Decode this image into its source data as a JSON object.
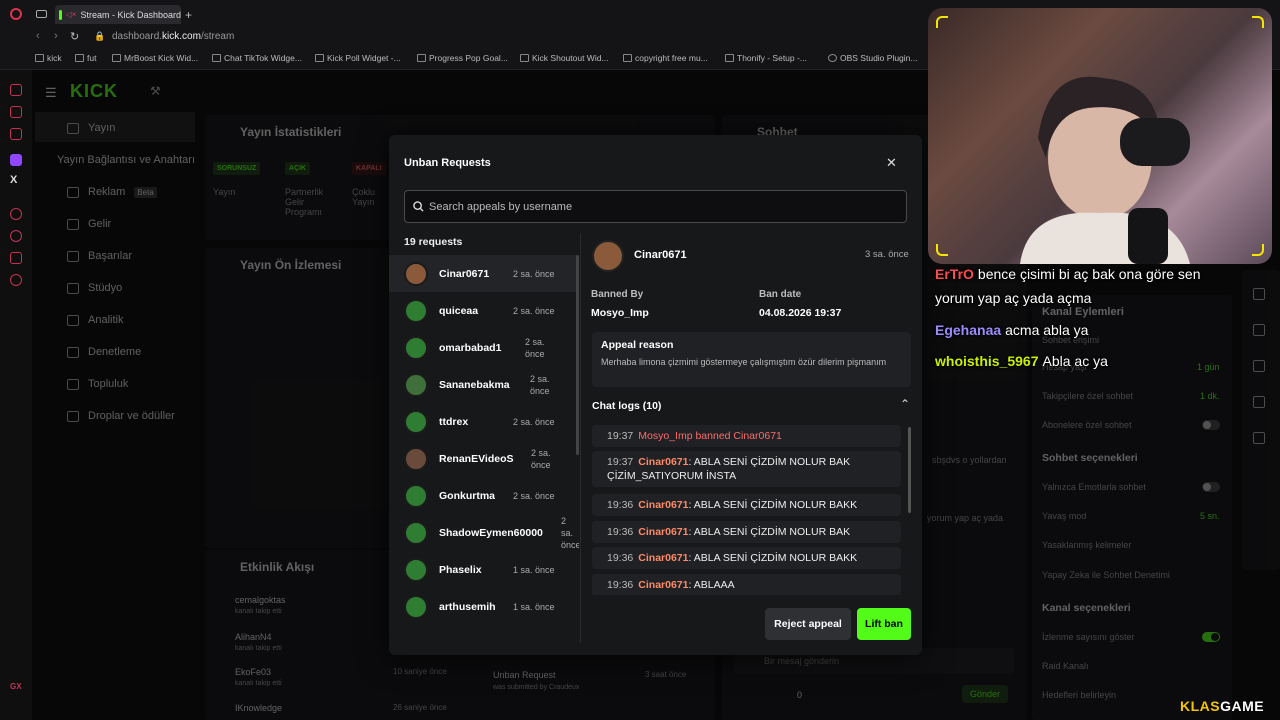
{
  "browser": {
    "tab_title": "Stream - Kick Dashboard",
    "url_prefix": "dashboard.",
    "url_domain": "kick.com",
    "url_path": "/stream",
    "bookmarks": [
      "kick",
      "fut",
      "MrBoost Kick Wid...",
      "Chat TikTok Widge...",
      "Kick Poll Widget -...",
      "Progress Pop Goal...",
      "Kick Shoutout Wid...",
      "copyright free mu...",
      "Thonify - Setup -...",
      "OBS Studio Plugin..."
    ]
  },
  "sidebar": {
    "logo": "KICK",
    "items": [
      {
        "label": "Yayın"
      },
      {
        "label": "Yayın Bağlantısı ve Anahtarı"
      },
      {
        "label": "Reklam",
        "badge": "Beta"
      },
      {
        "label": "Gelir"
      },
      {
        "label": "Başarılar"
      },
      {
        "label": "Stüdyo"
      },
      {
        "label": "Analitik"
      },
      {
        "label": "Denetleme"
      },
      {
        "label": "Topluluk"
      },
      {
        "label": "Droplar ve ödüller"
      }
    ]
  },
  "background": {
    "stats_title": "Yayın İstatistikleri",
    "stats_pills": [
      "SORUNSUZ",
      "AÇIK",
      "KAPALI"
    ],
    "stats_labels": [
      "Yayın",
      "Partnerlik Gelir Programı",
      "Çoklu Yayın"
    ],
    "preview_title": "Yayın Ön İzlemesi",
    "activity_title": "Etkinlik Akışı",
    "activity": [
      {
        "user": "cemalgoktas",
        "sub": "kanalı takip etti"
      },
      {
        "user": "AlihanN4",
        "sub": "kanalı takip etti"
      },
      {
        "user": "EkoFe03",
        "sub": "kanalı takip etti",
        "time": "10 saniye önce"
      },
      {
        "user": "IKnowledge",
        "time": "26 saniye önce"
      }
    ],
    "chat_title": "Sohbet",
    "chat_placeholder": "Bir mesaj gönderin",
    "chat_send": "Gönder",
    "chat_count": "0",
    "unban_note_title": "Unban Request",
    "unban_note_sub": "was submitted by Craudeux",
    "unban_note_time": "3 saat önce",
    "chat_snippet_1": "sbşdvs o yollardan",
    "chat_snippet_2": "yorum yap aç yada",
    "channel_actions_title": "Kanal Eylemleri",
    "chat_access": "Sohbet erişimi",
    "account_age": "Hesap yaşı",
    "account_age_val": "1 gün",
    "followers_only": "Takipçilere özel sohbet",
    "followers_only_val": "1 dk.",
    "subs_only": "Abonelere özel sohbet",
    "chat_options_title": "Sohbet seçenekleri",
    "emotes_only": "Yalnızca Emotlarla sohbet",
    "slow_mode": "Yavaş mod",
    "slow_mode_val": "5 sn.",
    "banned_words": "Yasaklanmış kelimeler",
    "ai_moderation": "Yapay Zeka ile Sohbet Denetimi",
    "channel_options_title": "Kanal seçenekleri",
    "show_viewers": "İzlenme sayısını göster",
    "raid": "Raid Kanalı",
    "goals": "Hedefleri belirleyin"
  },
  "modal": {
    "title": "Unban Requests",
    "close": "✕",
    "search_placeholder": "Search appeals by username",
    "request_count": "19 requests",
    "requests": [
      {
        "user": "Cinar0671",
        "time": "2 sa. önce",
        "color": "#8a5a3a"
      },
      {
        "user": "quiceaa",
        "time": "2 sa. önce",
        "color": "#2e7d32"
      },
      {
        "user": "omarbabad1",
        "time": "2 sa. önce",
        "color": "#2e7d32"
      },
      {
        "user": "Sananebakma",
        "time": "2 sa. önce",
        "color": "#3f6f3a"
      },
      {
        "user": "ttdrex",
        "time": "2 sa. önce",
        "color": "#2e7d32"
      },
      {
        "user": "RenanEVideoS",
        "time": "2 sa. önce",
        "color": "#6a4a3a"
      },
      {
        "user": "Gonkurtma",
        "time": "2 sa. önce",
        "color": "#2e7d32"
      },
      {
        "user": "ShadowEymen60000",
        "time": "2 sa. önce",
        "color": "#2e7d32"
      },
      {
        "user": "Phaselix",
        "time": "1 sa. önce",
        "color": "#2e7d32"
      },
      {
        "user": "arthusemih",
        "time": "1 sa. önce",
        "color": "#2e7d32"
      }
    ],
    "detail": {
      "user": "Cinar0671",
      "time": "3 sa. önce",
      "banned_by_label": "Banned By",
      "banned_by": "Mosyo_Imp",
      "ban_date_label": "Ban date",
      "ban_date": "04.08.2026 19:37",
      "appeal_reason_label": "Appeal reason",
      "appeal_reason": "Merhaba limona çizmimi göstermeye çalışmıştım özür dilerim pişmanım",
      "chat_logs_label": "Chat logs (10)",
      "logs": [
        {
          "time": "19:37",
          "system": "Mosyo_Imp banned Cinar0671"
        },
        {
          "time": "19:37",
          "user": "Cinar0671",
          "text": ": ABLA SENİ ÇİZDİM NOLUR BAK ÇİZİM_SATIYORUM İNSTA"
        },
        {
          "time": "19:36",
          "user": "Cinar0671",
          "text": ": ABLA SENİ ÇİZDİM NOLUR BAKK"
        },
        {
          "time": "19:36",
          "user": "Cinar0671",
          "text": ": ABLA SENİ ÇİZDİM NOLUR BAK"
        },
        {
          "time": "19:36",
          "user": "Cinar0671",
          "text": ": ABLA SENİ ÇİZDİM NOLUR BAKK"
        },
        {
          "time": "19:36",
          "user": "Cinar0671",
          "text": ": ABLAAA"
        }
      ],
      "reject_label": "Reject appeal",
      "lift_label": "Lift ban"
    }
  },
  "overlay_chat": [
    {
      "user": "ErTrO",
      "text": "bence çisimi bi aç bak ona göre sen",
      "color": "#ff4d4d"
    },
    {
      "user": "",
      "text": "yorum yap aç yada açma",
      "color": "#ffffff"
    },
    {
      "user": "Egehanaa",
      "text": "acma abla ya",
      "color": "#9b8cff"
    },
    {
      "user": "whoisthis_5967",
      "text": "Abla ac ya",
      "color": "#c8f000"
    }
  ],
  "watermark": {
    "part1": "KLAS",
    "part2": "GAME"
  },
  "colors": {
    "kick_green": "#53fc18",
    "modal_bg": "#17181a",
    "username_orange": "#ff8a65",
    "ban_red": "#ff6b6b"
  }
}
